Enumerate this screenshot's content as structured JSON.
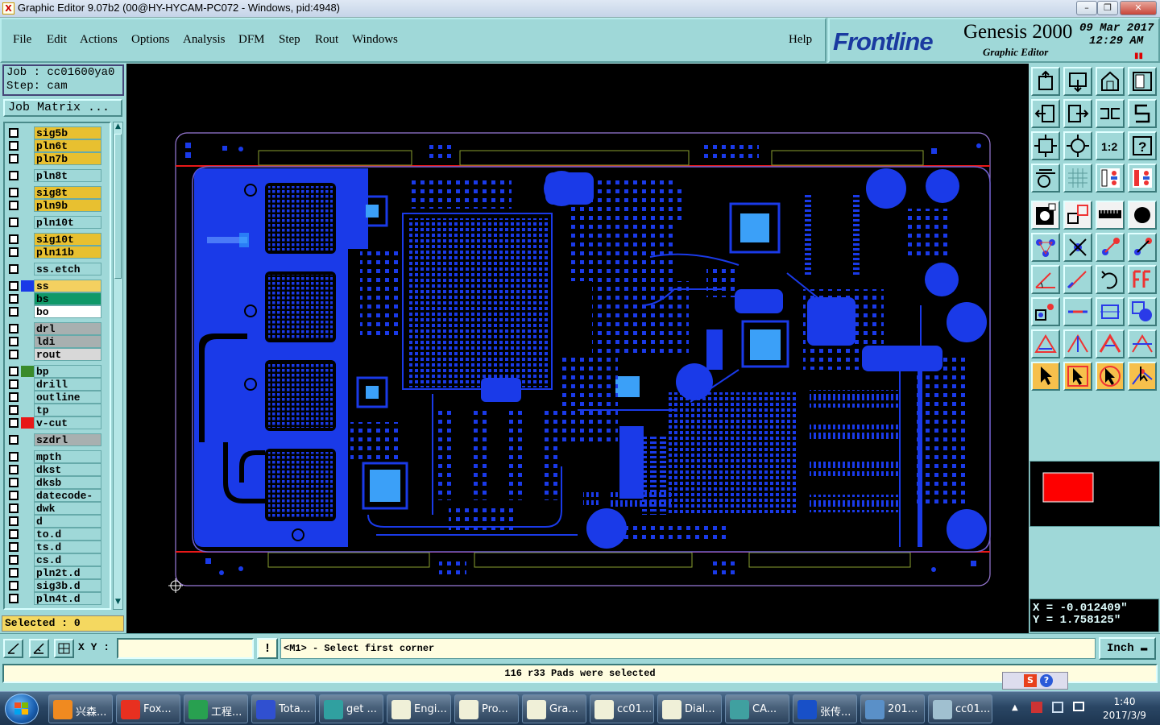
{
  "window": {
    "title": "Graphic Editor 9.07b2 (00@HY-HYCAM-PC072 - Windows, pid:4948)",
    "icon_text": "X",
    "controls": [
      "minimize-icon",
      "restore-icon",
      "close-icon"
    ]
  },
  "menu": {
    "items": [
      "File",
      "Edit",
      "Actions",
      "Options",
      "Analysis",
      "DFM",
      "Step",
      "Rout",
      "Windows"
    ],
    "help": "Help"
  },
  "logo": {
    "brand": "Frontline",
    "product": "Genesis 2000",
    "subtitle": "Graphic Editor",
    "date": "09 Mar 2017",
    "time": "12:29  AM"
  },
  "job": {
    "job_label": "Job : cc01600ya0",
    "step_label": "Step: cam",
    "matrix_button": "Job Matrix ..."
  },
  "layers": [
    {
      "name": "sig5b",
      "color": "#e8c030",
      "swatch": ""
    },
    {
      "name": "pln6t",
      "color": "#e8c030",
      "swatch": ""
    },
    {
      "name": "pln7b",
      "color": "#e8c030",
      "swatch": ""
    },
    {
      "name": "pln8t",
      "color": "#9fd8d8",
      "swatch": ""
    },
    {
      "name": "sig8t",
      "color": "#e8c030",
      "swatch": ""
    },
    {
      "name": "pln9b",
      "color": "#e8c030",
      "swatch": ""
    },
    {
      "name": "pln10t",
      "color": "#9fd8d8",
      "swatch": ""
    },
    {
      "name": "sig10t",
      "color": "#e8c030",
      "swatch": ""
    },
    {
      "name": "pln11b",
      "color": "#e8c030",
      "swatch": ""
    },
    {
      "name": "ss.etch",
      "color": "#9fd8d8",
      "swatch": ""
    },
    {
      "name": "ss",
      "color": "#f4d060",
      "swatch": "#1a3ae8"
    },
    {
      "name": "bs",
      "color": "#109868",
      "swatch": ""
    },
    {
      "name": "bo",
      "color": "#ffffff",
      "swatch": ""
    },
    {
      "name": "drl",
      "color": "#a8b0b0",
      "swatch": ""
    },
    {
      "name": "ldi",
      "color": "#a8b0b0",
      "swatch": ""
    },
    {
      "name": "rout",
      "color": "#d8d8d8",
      "swatch": ""
    },
    {
      "name": "bp",
      "color": "#9fd8d8",
      "swatch": "#3a8a2a"
    },
    {
      "name": "drill",
      "color": "#9fd8d8",
      "swatch": ""
    },
    {
      "name": "outline",
      "color": "#9fd8d8",
      "swatch": ""
    },
    {
      "name": "tp",
      "color": "#9fd8d8",
      "swatch": ""
    },
    {
      "name": "v-cut",
      "color": "#9fd8d8",
      "swatch": "#e81818"
    },
    {
      "name": "szdrl",
      "color": "#a8b0b0",
      "swatch": ""
    },
    {
      "name": "mpth",
      "color": "#9fd8d8",
      "swatch": ""
    },
    {
      "name": "dkst",
      "color": "#9fd8d8",
      "swatch": ""
    },
    {
      "name": "dksb",
      "color": "#9fd8d8",
      "swatch": ""
    },
    {
      "name": "datecode-to",
      "color": "#9fd8d8",
      "swatch": ""
    },
    {
      "name": "dwk",
      "color": "#9fd8d8",
      "swatch": ""
    },
    {
      "name": "d",
      "color": "#9fd8d8",
      "swatch": ""
    },
    {
      "name": "to.d",
      "color": "#9fd8d8",
      "swatch": ""
    },
    {
      "name": "ts.d",
      "color": "#9fd8d8",
      "swatch": ""
    },
    {
      "name": "cs.d",
      "color": "#9fd8d8",
      "swatch": ""
    },
    {
      "name": "pln2t.d",
      "color": "#9fd8d8",
      "swatch": ""
    },
    {
      "name": "sig3b.d",
      "color": "#9fd8d8",
      "swatch": ""
    },
    {
      "name": "pln4t.d",
      "color": "#9fd8d8",
      "swatch": ""
    }
  ],
  "selected_label": "Selected : 0",
  "coords": {
    "x": "X = -0.012409\"",
    "y": "Y = 1.758125\""
  },
  "command": {
    "xy_label": "X Y :",
    "xy_value": "",
    "bang": "!",
    "prompt": "<M1> - Select first corner",
    "unit": "Inch"
  },
  "status": "116 r33 Pads were selected",
  "toolbar_icons": [
    "home-icon",
    "step-down-icon",
    "house-icon",
    "window-icon",
    "arrow-left-icon",
    "arrow-right-icon",
    "pan-icon",
    "snake-icon",
    "zoom-fit-icon",
    "zoom-all-icon",
    "ratio-icon",
    "help-icon",
    "measure-icon",
    "grid-icon",
    "layers-icon",
    "layers-red-icon",
    "pad-icon",
    "line-icon",
    "ruler-icon",
    "dot-icon",
    "node-icon",
    "cross-icon",
    "arc-icon",
    "rotate-line-icon",
    "angle-icon",
    "diag-icon",
    "undo-icon",
    "text-icon",
    "add-pad-icon",
    "minus-icon",
    "box-icon",
    "copy-icon",
    "tri1-icon",
    "tri2-icon",
    "tri3-icon",
    "tri4-icon",
    "pointer-icon",
    "select-box-icon",
    "select-arrow-icon",
    "route-icon"
  ],
  "taskbar": {
    "tasks": [
      {
        "label": "兴森...",
        "color": "#f08a20"
      },
      {
        "label": "Fox...",
        "color": "#e83020"
      },
      {
        "label": "工程...",
        "color": "#28a050"
      },
      {
        "label": "Tota...",
        "color": "#3050d0"
      },
      {
        "label": "get ...",
        "color": "#30a0a0"
      },
      {
        "label": "Engi...",
        "color": "#f0f0d8"
      },
      {
        "label": "Pro...",
        "color": "#f0f0d8"
      },
      {
        "label": "Gra...",
        "color": "#f0f0d8"
      },
      {
        "label": "cc01...",
        "color": "#f0f0d8"
      },
      {
        "label": "Dial...",
        "color": "#f0f0d8"
      },
      {
        "label": "CA...",
        "color": "#40a0a0"
      },
      {
        "label": "张传...",
        "color": "#1850c8"
      },
      {
        "label": "201...",
        "color": "#5a90c8"
      },
      {
        "label": "cc01...",
        "color": "#a0c0d0"
      }
    ],
    "time": "1:40",
    "date": "2017/3/9"
  }
}
